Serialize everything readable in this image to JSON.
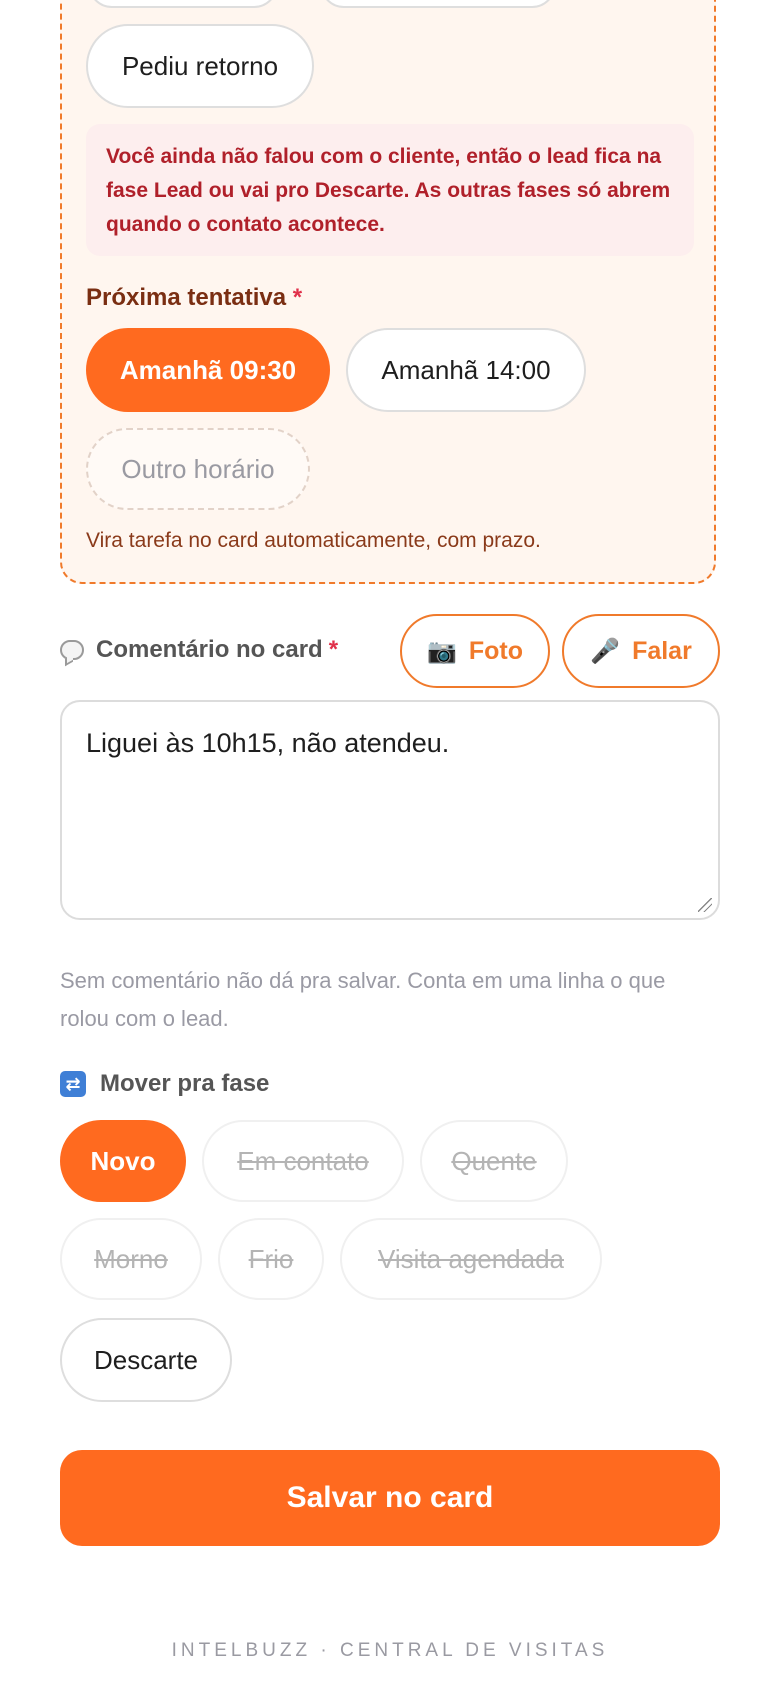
{
  "attempt": {
    "callback_label": "Pediu retorno",
    "warning": "Você ainda não falou com o cliente, então o lead fica na fase Lead ou vai pro Descarte. As outras fases só abrem quando o contato acontece.",
    "next_label": "Próxima tentativa",
    "required_mark": "*",
    "slots": [
      "Amanhã 09:30",
      "Amanhã 14:00"
    ],
    "other_slot": "Outro horário",
    "hint": "Vira tarefa no card automaticamente, com prazo."
  },
  "comment": {
    "label": "Comentário no card",
    "required_mark": "*",
    "photo_label": "Foto",
    "speak_label": "Falar",
    "value": "Liguei às 10h15, não atendeu.",
    "hint": "Sem comentário não dá pra salvar. Conta em uma linha o que rolou com o lead."
  },
  "move": {
    "label": "Mover pra fase",
    "stages": [
      "Novo",
      "Em contato",
      "Quente",
      "Morno",
      "Frio",
      "Visita agendada",
      "Descarte"
    ]
  },
  "save_label": "Salvar no card",
  "footer": "INTELBUZZ · CENTRAL DE VISITAS",
  "colors": {
    "accent": "#ff6a1f",
    "warning_text": "#b0202a"
  },
  "icons": {
    "chat": "chat-bubble-icon",
    "camera": "camera-icon",
    "mic": "microphone-icon",
    "shuffle": "shuffle-icon"
  }
}
